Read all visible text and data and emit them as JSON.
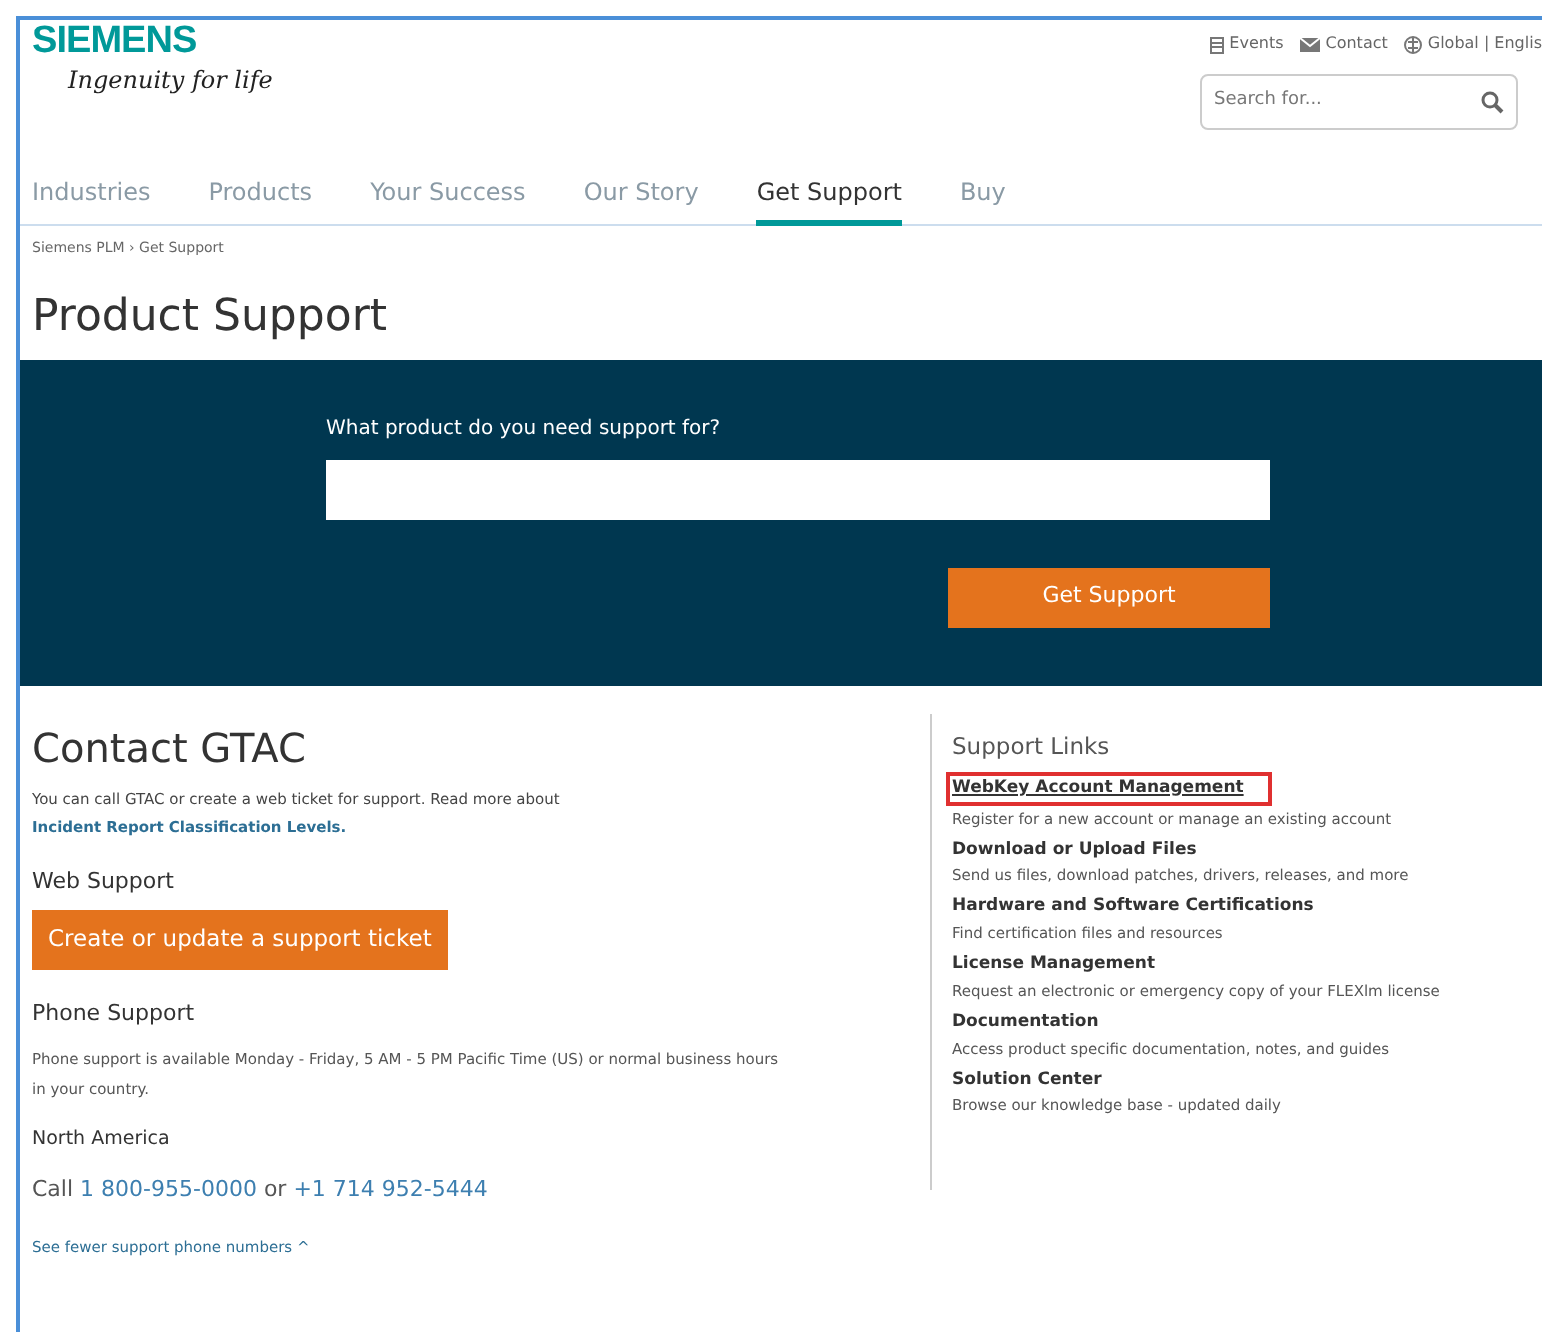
{
  "logo": {
    "brand": "SIEMENS",
    "tagline": "Ingenuity for life"
  },
  "utility_links": [
    {
      "kind": "calendar",
      "label": "Events"
    },
    {
      "kind": "mail",
      "label": "Contact"
    },
    {
      "kind": "globe",
      "label": "Global | Englis"
    }
  ],
  "search": {
    "placeholder": "Search for..."
  },
  "nav": [
    {
      "label": "Industries",
      "selected": false
    },
    {
      "label": "Products",
      "selected": false
    },
    {
      "label": "Your Success",
      "selected": false
    },
    {
      "label": "Our Story",
      "selected": false
    },
    {
      "label": "Get Support",
      "selected": true
    },
    {
      "label": "Buy",
      "selected": false
    }
  ],
  "breadcrumb": "Siemens PLM › Get Support",
  "page_title": "Product Support",
  "hero": {
    "label": "What product do you need support for?",
    "button": "Get Support"
  },
  "contact": {
    "title": "Contact GTAC",
    "intro": "You can call GTAC or create a web ticket for support. Read more about",
    "intro_link": "Incident Report Classification Levels.",
    "web_support": {
      "heading": "Web Support",
      "button": "Create or update a support ticket"
    },
    "phone_support": {
      "heading": "Phone Support",
      "text": "Phone support is available Monday - Friday, 5 AM - 5 PM Pacific Time (US) or normal business hours in your country."
    },
    "region": {
      "heading": "North America",
      "call": "Call",
      "number_1": "1 800-955-0000",
      "or": "or",
      "number_2": "+1 714 952-5444"
    },
    "toggle": "See fewer support phone numbers ^"
  },
  "support_links": {
    "title": "Support Links",
    "items": [
      {
        "title": "WebKey Account Management",
        "description": "Register for a new account or manage an existing account",
        "highlighted": true
      },
      {
        "title": "Download or Upload Files",
        "description": "Send us files, download patches, drivers, releases, and more",
        "highlighted": false
      },
      {
        "title": "Hardware and Software Certifications",
        "description": "Find certification files and resources",
        "highlighted": false
      },
      {
        "title": "License Management",
        "description": "Request an electronic or emergency copy of your FLEXlm license",
        "highlighted": false
      },
      {
        "title": "Documentation",
        "description": "Access product specific documentation, notes, and guides",
        "highlighted": false
      },
      {
        "title": "Solution Center",
        "description": "Browse our knowledge base - updated daily",
        "highlighted": false
      }
    ]
  }
}
